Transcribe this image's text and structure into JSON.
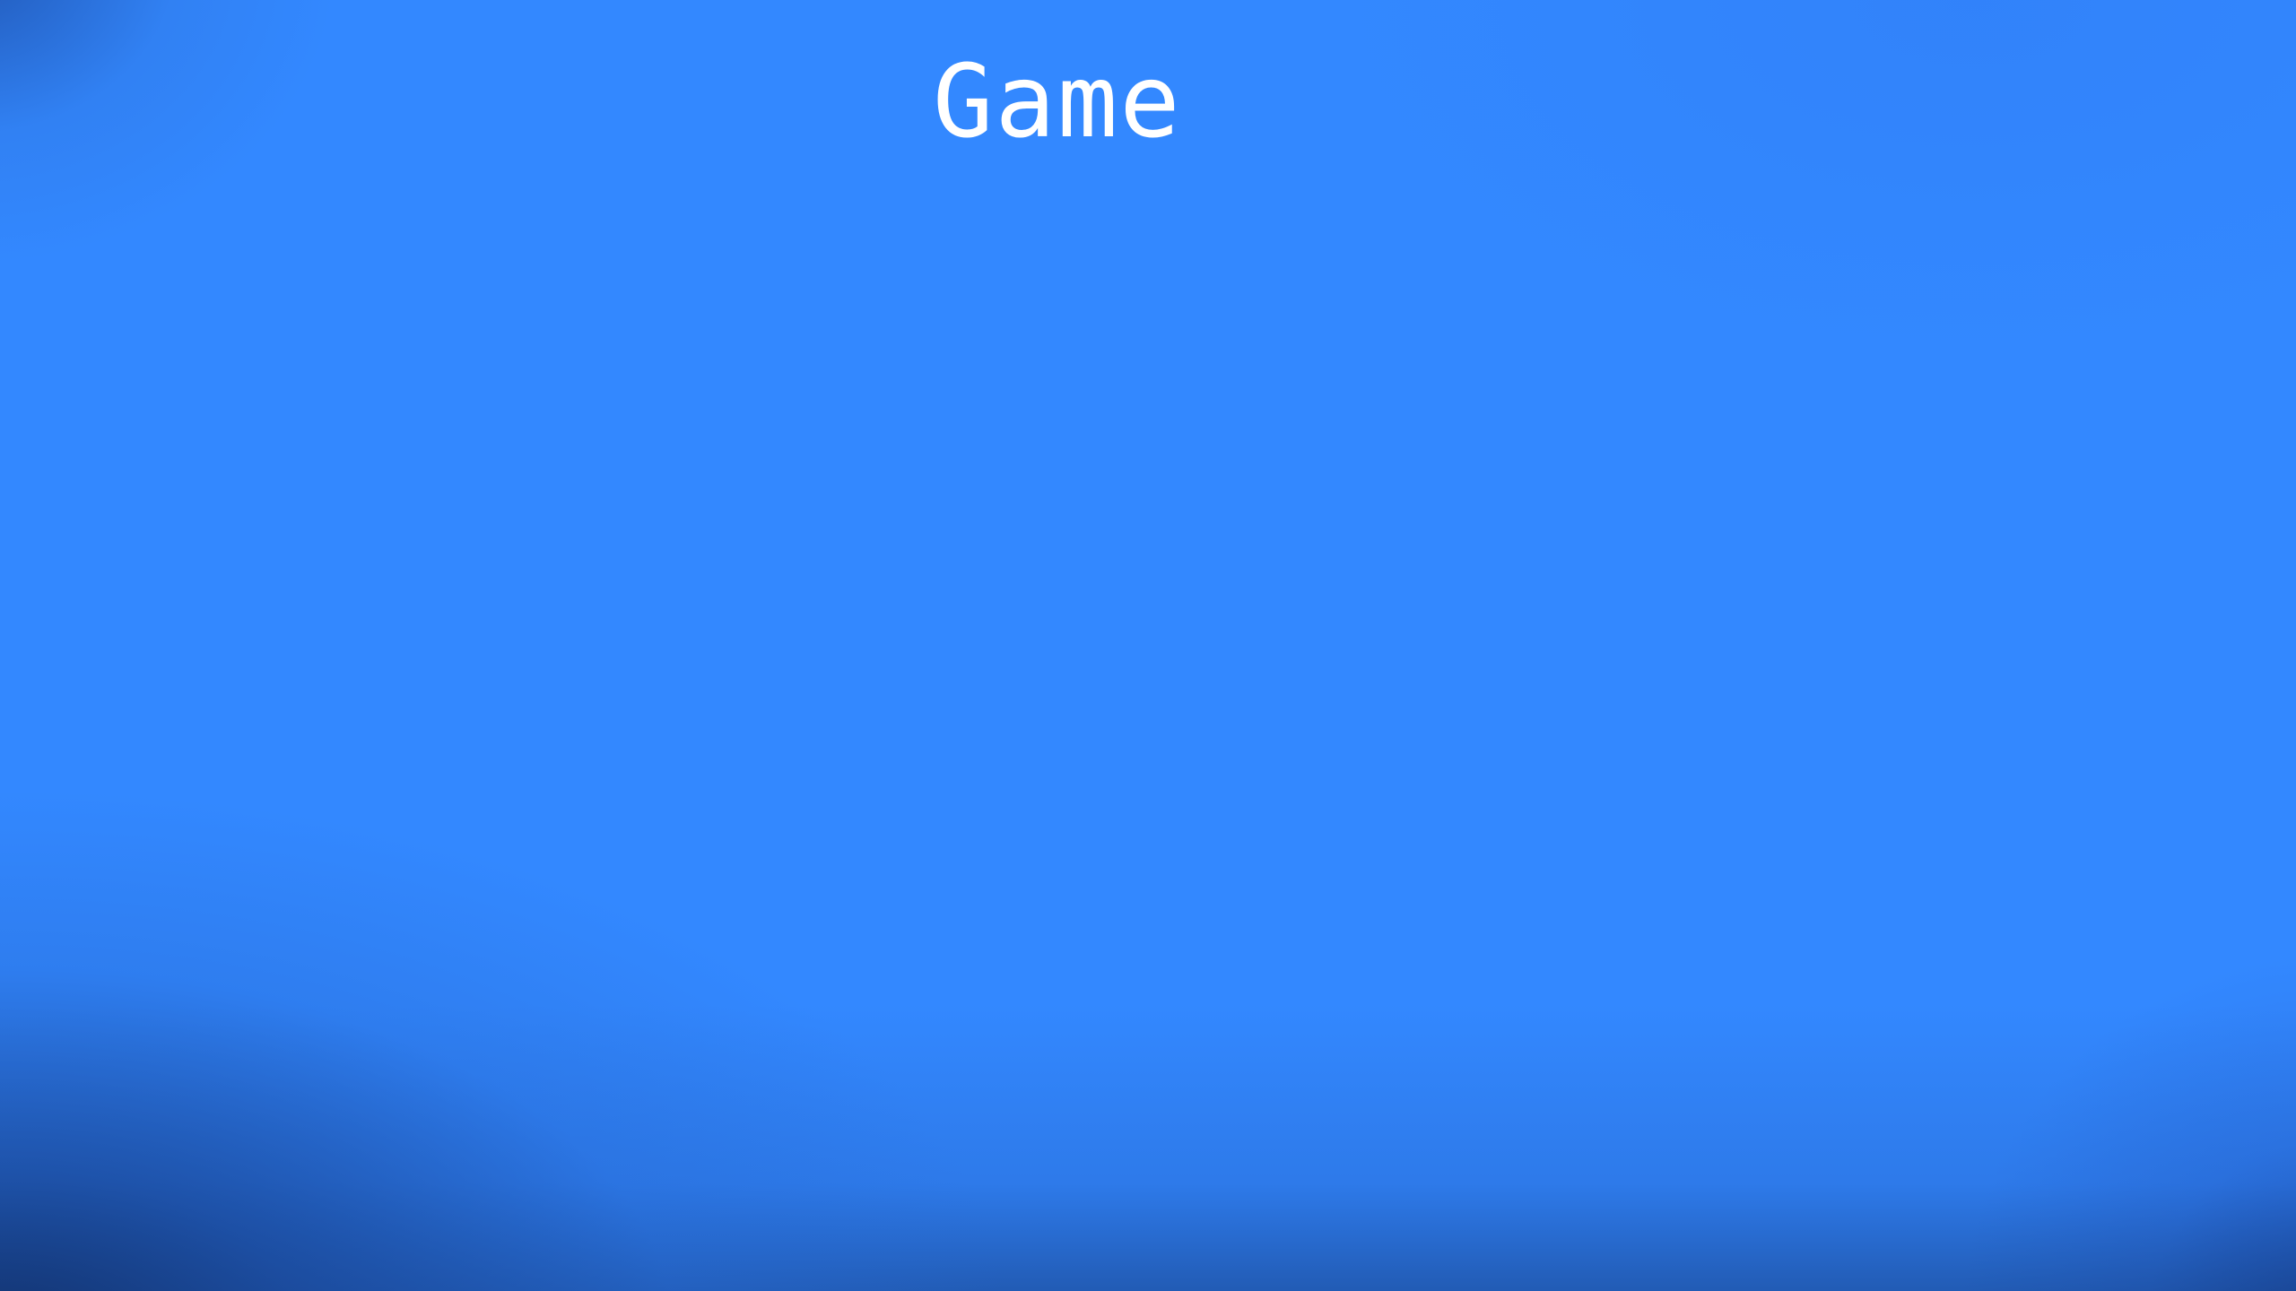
{
  "title": "Game",
  "colors": {
    "background": "#3388ff",
    "vignette": "#1a3f8a",
    "title_text": "#ffffff"
  }
}
